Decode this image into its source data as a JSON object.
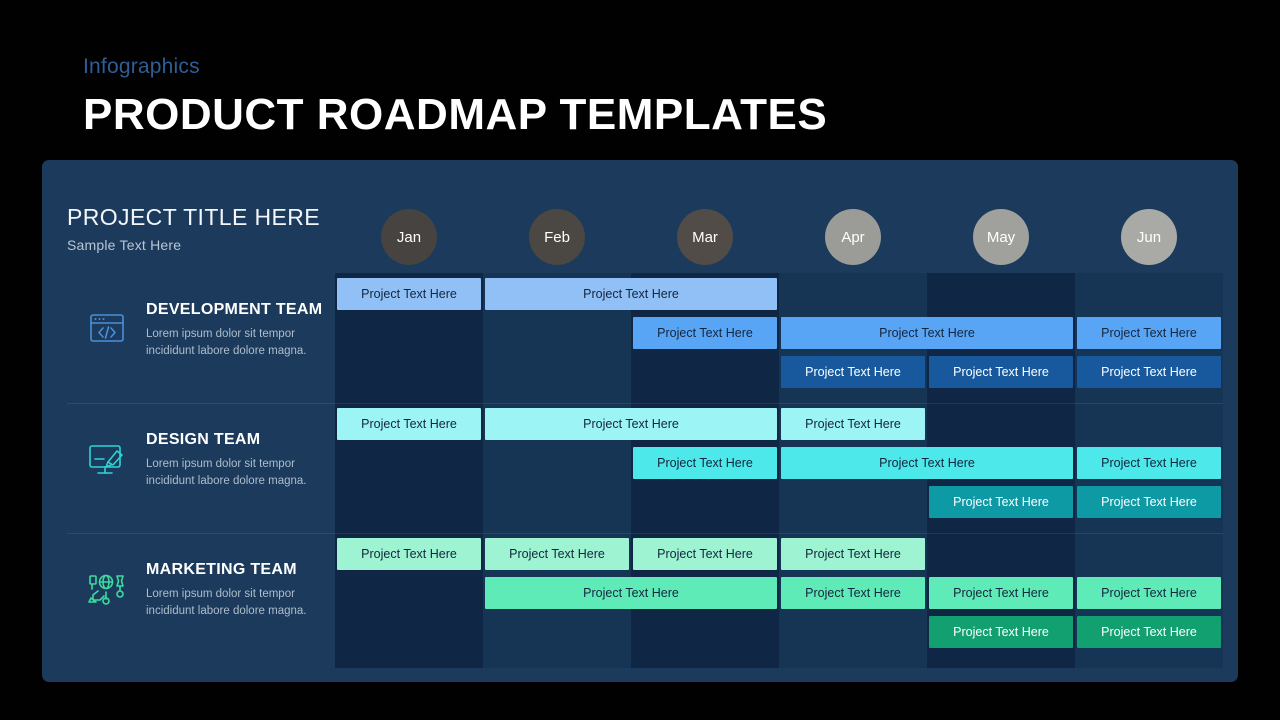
{
  "header": {
    "kicker": "Infographics",
    "title": "PRODUCT ROADMAP TEMPLATES"
  },
  "card": {
    "project_title": "PROJECT TITLE HERE",
    "project_subtitle": "Sample Text Here",
    "background_color": "#1b3a5c"
  },
  "months": [
    {
      "label": "Jan",
      "color": "#464340"
    },
    {
      "label": "Feb",
      "color": "#4b4743"
    },
    {
      "label": "Mar",
      "color": "#514c47"
    },
    {
      "label": "Apr",
      "color": "#9b9b98"
    },
    {
      "label": "May",
      "color": "#a0a09d"
    },
    {
      "label": "Jun",
      "color": "#a9a9a6"
    }
  ],
  "columns": [
    {
      "label": "Jan",
      "bg": "#0f2744"
    },
    {
      "label": "Feb",
      "bg": "#163453"
    },
    {
      "label": "Mar",
      "bg": "#0f2744"
    },
    {
      "label": "Apr",
      "bg": "#163453"
    },
    {
      "label": "May",
      "bg": "#0f2744"
    },
    {
      "label": "Jun",
      "bg": "#163453"
    }
  ],
  "bar_label": "Project Text Here",
  "teams": [
    {
      "name": "DEVELOPMENT TEAM",
      "description": "Lorem ipsum dolor sit tempor incididunt labore dolore magna.",
      "icon": "code-window-icon",
      "icon_color": "#4a90d9",
      "rows": [
        [
          {
            "start": 0,
            "span": 1,
            "color": "#90c0f5",
            "text_color": "#14263d",
            "label": "Project Text Here"
          },
          {
            "start": 1,
            "span": 2,
            "color": "#90c0f5",
            "text_color": "#14263d",
            "label": "Project Text Here"
          }
        ],
        [
          {
            "start": 2,
            "span": 1,
            "color": "#59a5f5",
            "text_color": "#14263d",
            "label": "Project Text Here"
          },
          {
            "start": 3,
            "span": 2,
            "color": "#59a5f5",
            "text_color": "#14263d",
            "label": "Project Text Here"
          },
          {
            "start": 5,
            "span": 1,
            "color": "#59a5f5",
            "text_color": "#14263d",
            "label": "Project Text Here"
          }
        ],
        [
          {
            "start": 3,
            "span": 1,
            "color": "#18599e",
            "text_color": "#ffffff",
            "label": "Project Text Here"
          },
          {
            "start": 4,
            "span": 1,
            "color": "#18599e",
            "text_color": "#ffffff",
            "label": "Project Text Here"
          },
          {
            "start": 5,
            "span": 1,
            "color": "#18599e",
            "text_color": "#ffffff",
            "label": "Project Text Here"
          }
        ]
      ]
    },
    {
      "name": "DESIGN TEAM",
      "description": "Lorem ipsum dolor sit tempor incididunt labore dolore magna.",
      "icon": "monitor-brush-icon",
      "icon_color": "#2dd4d4",
      "rows": [
        [
          {
            "start": 0,
            "span": 1,
            "color": "#9cf4f4",
            "text_color": "#14263d",
            "label": "Project Text Here"
          },
          {
            "start": 1,
            "span": 2,
            "color": "#9cf4f4",
            "text_color": "#14263d",
            "label": "Project Text Here"
          },
          {
            "start": 3,
            "span": 1,
            "color": "#9cf4f4",
            "text_color": "#14263d",
            "label": "Project Text Here"
          }
        ],
        [
          {
            "start": 2,
            "span": 1,
            "color": "#4ce8ea",
            "text_color": "#14263d",
            "label": "Project Text Here"
          },
          {
            "start": 3,
            "span": 2,
            "color": "#4ce8ea",
            "text_color": "#14263d",
            "label": "Project Text Here"
          },
          {
            "start": 5,
            "span": 1,
            "color": "#4ce8ea",
            "text_color": "#14263d",
            "label": "Project Text Here"
          }
        ],
        [
          {
            "start": 4,
            "span": 1,
            "color": "#0d9aa5",
            "text_color": "#ffffff",
            "label": "Project Text Here"
          },
          {
            "start": 5,
            "span": 1,
            "color": "#0d9aa5",
            "text_color": "#ffffff",
            "label": "Project Text Here"
          }
        ]
      ]
    },
    {
      "name": "MARKETING TEAM",
      "description": "Lorem ipsum dolor sit tempor incididunt labore dolore magna.",
      "icon": "marketing-network-icon",
      "icon_color": "#3ddba0",
      "rows": [
        [
          {
            "start": 0,
            "span": 1,
            "color": "#9df3d2",
            "text_color": "#14263d",
            "label": "Project Text Here"
          },
          {
            "start": 1,
            "span": 1,
            "color": "#9df3d2",
            "text_color": "#14263d",
            "label": "Project Text Here"
          },
          {
            "start": 2,
            "span": 1,
            "color": "#9df3d2",
            "text_color": "#14263d",
            "label": "Project Text Here"
          },
          {
            "start": 3,
            "span": 1,
            "color": "#9df3d2",
            "text_color": "#14263d",
            "label": "Project Text Here"
          }
        ],
        [
          {
            "start": 1,
            "span": 2,
            "color": "#5eebb8",
            "text_color": "#14263d",
            "label": "Project Text Here"
          },
          {
            "start": 3,
            "span": 1,
            "color": "#5eebb8",
            "text_color": "#14263d",
            "label": "Project Text Here"
          },
          {
            "start": 4,
            "span": 1,
            "color": "#5eebb8",
            "text_color": "#14263d",
            "label": "Project Text Here"
          },
          {
            "start": 5,
            "span": 1,
            "color": "#5eebb8",
            "text_color": "#14263d",
            "label": "Project Text Here"
          }
        ],
        [
          {
            "start": 4,
            "span": 1,
            "color": "#12a070",
            "text_color": "#ffffff",
            "label": "Project Text Here"
          },
          {
            "start": 5,
            "span": 1,
            "color": "#12a070",
            "text_color": "#ffffff",
            "label": "Project Text Here"
          }
        ]
      ]
    }
  ]
}
